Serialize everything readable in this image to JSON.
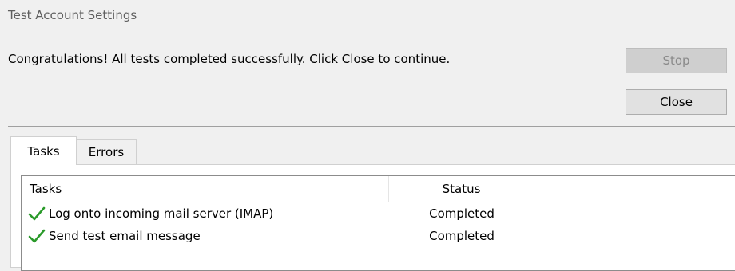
{
  "window": {
    "title": "Test Account Settings"
  },
  "message": "Congratulations! All tests completed successfully. Click Close to continue.",
  "buttons": {
    "stop_label": "Stop",
    "close_label": "Close"
  },
  "tabs": [
    {
      "label": "Tasks",
      "selected": true
    },
    {
      "label": "Errors",
      "selected": false
    }
  ],
  "table": {
    "columns": [
      "Tasks",
      "Status"
    ],
    "rows": [
      {
        "task": "Log onto incoming mail server (IMAP)",
        "status": "Completed",
        "icon": "check-icon"
      },
      {
        "task": "Send test email message",
        "status": "Completed",
        "icon": "check-icon"
      }
    ]
  },
  "colors": {
    "check": "#2a9a2a"
  }
}
